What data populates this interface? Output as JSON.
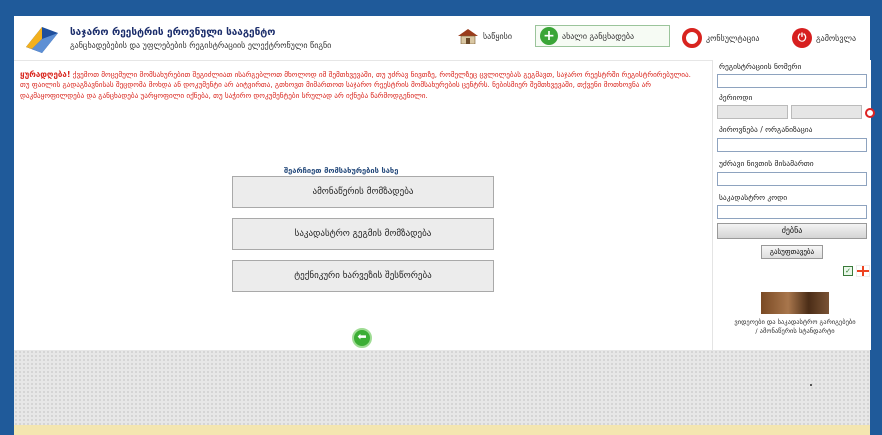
{
  "header": {
    "title": "საჯარო რეესტრის ეროვნული სააგენტო",
    "subtitle": "განცხადებების და უფლებების რეგისტრაციის ელექტრონული წიგნი",
    "nav": {
      "home": "საწყისი",
      "new_application": "ახალი განცხადება",
      "consultation": "კონსულტაცია",
      "exit": "გამოსვლა"
    }
  },
  "warning": {
    "lead": "ყურადღება!",
    "body": "ქვემოთ მოცემული მომსახურებით შეგიძლიათ ისარგებლოთ მხოლოდ იმ შემთხვევაში, თუ უძრავ ნივთზე, რომელზეც ცვლილებას გეგმავთ, საჯარო რეესტრში რეგისტრირებულია. თუ ფაილის გადაგზავნისას შეცდომა მოხდა ან დოკუმენტი არ აიტვირთა, გთხოვთ მიმართოთ საჯარო რეესტრის მომსახურების ცენტრს. ნებისმიერ შემთხვევაში, თქვენი მოთხოვნა არ დაკმაყოფილდება და განცხადება უარყოფილი იქნება, თუ საჭირო დოკუმენტები სრულად არ იქნება წარმოდგენილი."
  },
  "main": {
    "select_title": "შეარჩიეთ მომსახურების სახე",
    "buttons": [
      {
        "label": "ამონაწერის მომზადება"
      },
      {
        "label": "საკადასტრო გეგმის მომზადება"
      },
      {
        "label": "ტექნიკური ხარვეზის შესწორება"
      }
    ]
  },
  "sidebar": {
    "registration_number_label": "რეგისტრაციის ნომერი",
    "period_label": "პერიოდი",
    "person_label": "პიროვნება / ორგანიზაცია",
    "address_label": "უძრავი ნივთის მისამართი",
    "cadastral_label": "საკადასტრო კოდი",
    "search_button": "ძებნა",
    "clear_button": "გასუფთავება",
    "promo_text": "ვიდეოები და საკადასტრო გარიგებები / ამონაწერის სტანდარტი"
  },
  "colors": {
    "frame": "#1f5a9a",
    "warning_red": "#d9251d",
    "brand_navy": "#1b2d6b",
    "accent_green": "#3aa537"
  }
}
